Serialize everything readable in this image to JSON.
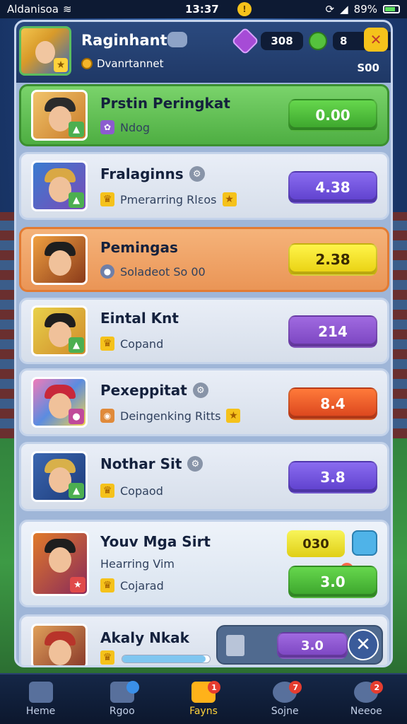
{
  "status_bar": {
    "carrier": "Aldanisoa",
    "time": "13:37",
    "battery": "89%"
  },
  "header": {
    "player_name": "Raginhant",
    "player_sub": "Dvanrtannet",
    "gem_count": "308",
    "emerald_count": "8",
    "rank_tag": "S00"
  },
  "rows": [
    {
      "title": "Prstin Peringkat",
      "subtitle": "Ndog",
      "score": "0.00",
      "score_color": "green",
      "row_style": "green"
    },
    {
      "title": "Fralaginns",
      "subtitle": "Pmerarring Rlεos",
      "score": "4.38",
      "score_color": "purple",
      "row_style": "normal"
    },
    {
      "title": "Pemingas",
      "subtitle": "Soladeot So 00",
      "score": "2.38",
      "score_color": "yellow",
      "row_style": "orange"
    },
    {
      "title": "Eintal Knt",
      "subtitle": "Copand",
      "score": "214",
      "score_color": "violet",
      "row_style": "normal"
    },
    {
      "title": "Pexeppitat",
      "subtitle": "Deingenking Ritts",
      "score": "8.4",
      "score_color": "orange",
      "row_style": "normal"
    },
    {
      "title": "Nothar Sit",
      "subtitle": "Copaod",
      "score": "3.8",
      "score_color": "purple",
      "row_style": "normal"
    }
  ],
  "self_row": {
    "title": "Youv Mga Sirt",
    "line2": "Hearring Vim",
    "line3": "Cojarad",
    "small_score": "030",
    "score": "3.0"
  },
  "partial_row": {
    "title": "Akaly Nkak",
    "score": "3.0",
    "progress": 0.95
  },
  "nav": [
    {
      "label": "Heme",
      "icon": "home-icon",
      "badge": ""
    },
    {
      "label": "Rgoo",
      "icon": "search-icon",
      "badge": ""
    },
    {
      "label": "Fayns",
      "icon": "home-flag-icon",
      "badge": "1"
    },
    {
      "label": "Sojne",
      "icon": "target-icon",
      "badge": "7"
    },
    {
      "label": "Neeoe",
      "icon": "settings-icon",
      "badge": "2"
    }
  ]
}
